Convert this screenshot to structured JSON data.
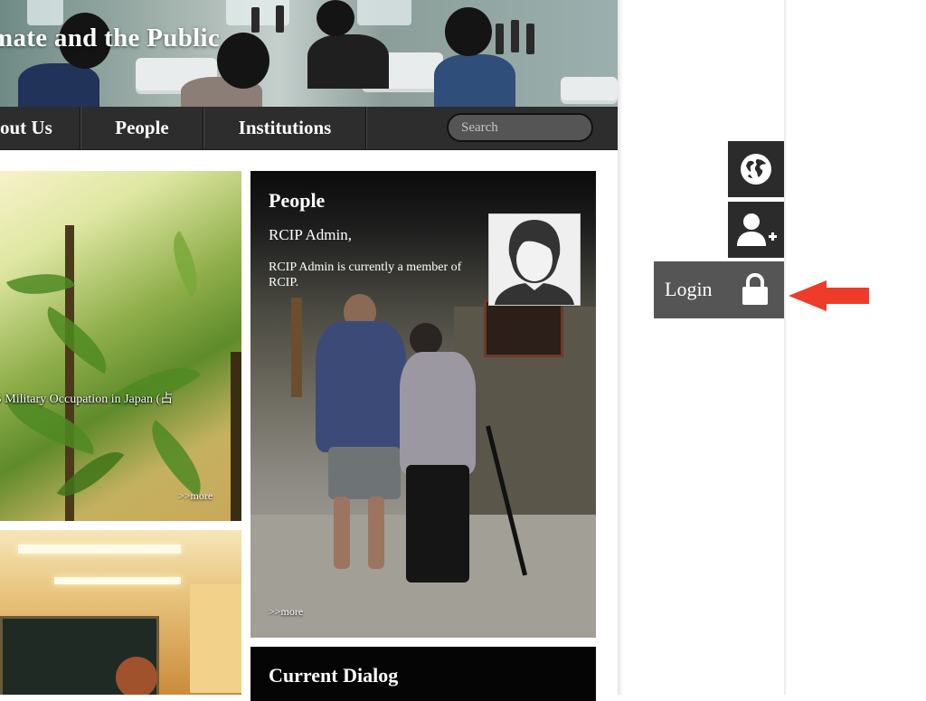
{
  "banner": {
    "title": "mate and the Public"
  },
  "nav": {
    "items": [
      {
        "label": "out Us"
      },
      {
        "label": "People"
      },
      {
        "label": "Institutions"
      }
    ],
    "search_placeholder": "Search"
  },
  "tiles": {
    "left_top": {
      "caption": "S Military Occupation in Japan (占",
      "more": ">>more"
    },
    "people": {
      "title": "People",
      "name": "RCIP Admin,",
      "description": "RCIP Admin is currently a member of RCIP.",
      "more": ">>more"
    },
    "dialog": {
      "title": "Current Dialog"
    }
  },
  "side_actions": {
    "login_label": "Login",
    "icons": [
      "globe-icon",
      "add-user-icon",
      "lock-icon"
    ]
  },
  "colors": {
    "nav_bg": "#2d2d2d",
    "login_bg": "#555555",
    "util_bg": "#2b2b2b",
    "arrow": "#ee3b2a"
  }
}
